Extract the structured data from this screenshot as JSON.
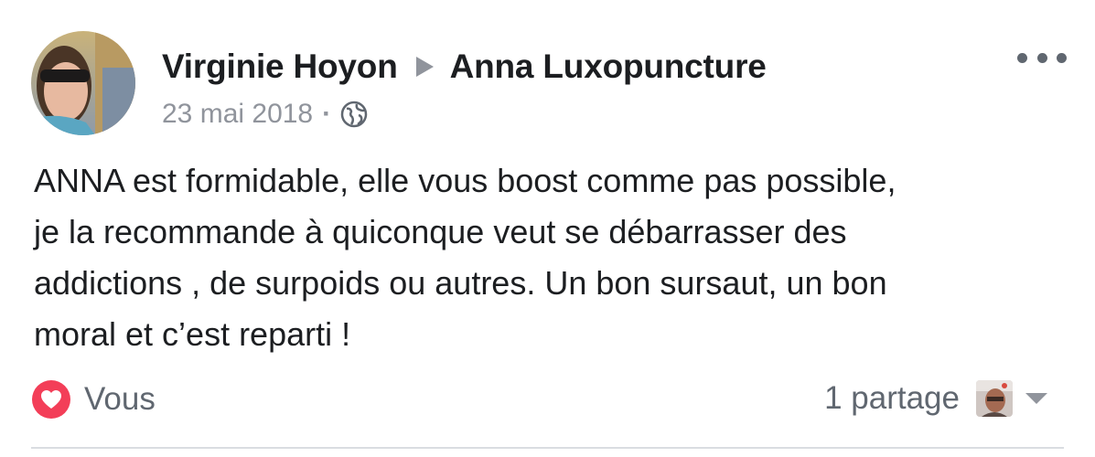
{
  "post": {
    "author": "Virginie Hoyon",
    "target_page": "Anna Luxopuncture",
    "date": "23 mai 2018",
    "separator": "·",
    "privacy_icon": "globe-icon",
    "text_lines": [
      "ANNA est formidable, elle vous boost comme pas possible,",
      "je la recommande à quiconque veut se débarrasser des",
      "addictions , de surpoids ou autres. Un bon sursaut, un bon",
      "moral et c’est reparti !"
    ]
  },
  "footer": {
    "reaction_icon": "love-reaction-icon",
    "reaction_label": "Vous",
    "shares_label": "1 partage"
  },
  "colors": {
    "text_primary": "#1c1e21",
    "text_secondary": "#90949c",
    "love_red": "#f33e58",
    "divider": "#dadde1"
  },
  "icons": {
    "more": "more-horizontal-icon",
    "arrow": "triangle-right-icon",
    "caret": "chevron-down-icon"
  }
}
